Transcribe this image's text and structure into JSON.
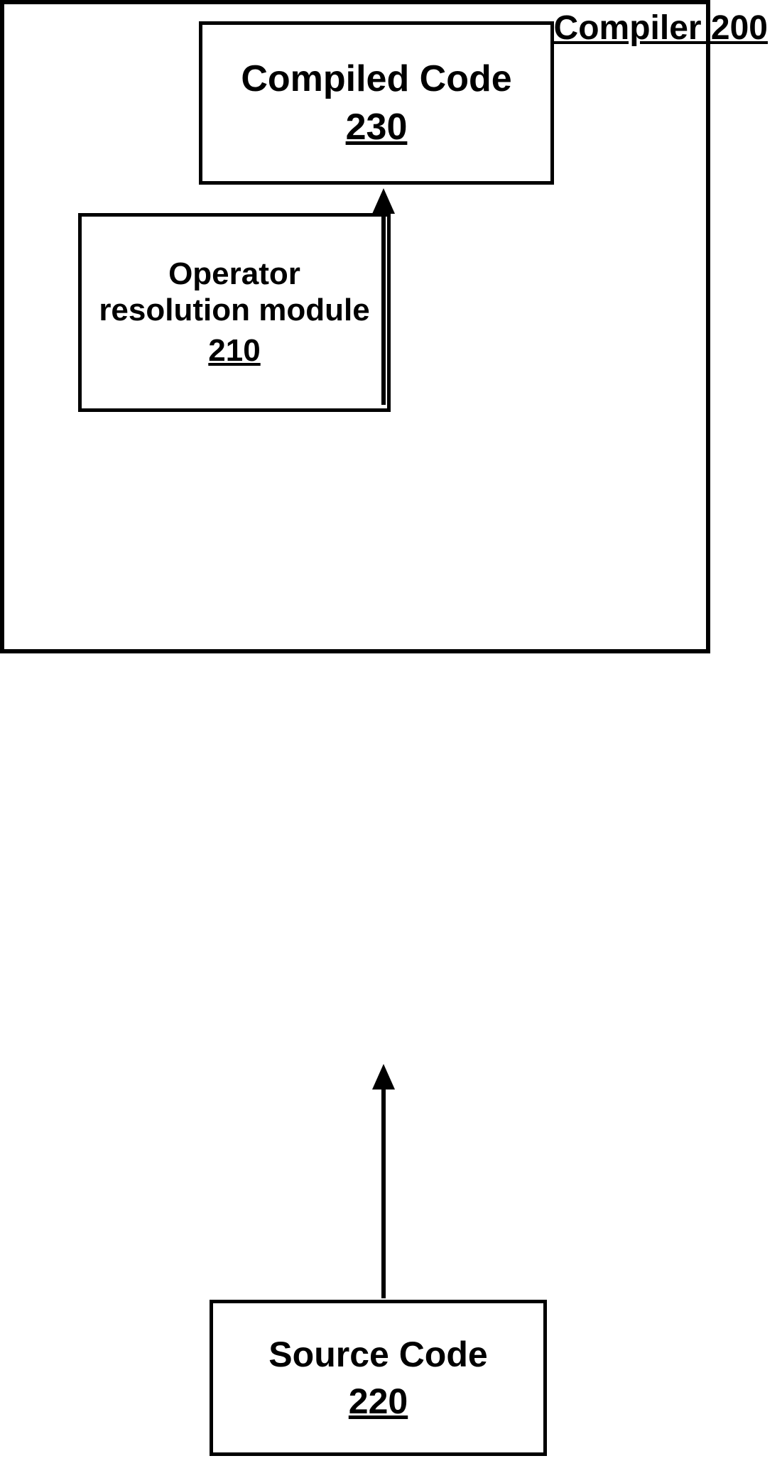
{
  "compiled_code": {
    "title": "Compiled Code",
    "number": "230"
  },
  "compiler": {
    "label_full": "Compiler 200",
    "name": "Compiler",
    "number": "200"
  },
  "operator_module": {
    "line1": "Operator",
    "line2": "resolution module",
    "number": "210"
  },
  "source_code": {
    "title": "Source Code",
    "number": "220"
  }
}
